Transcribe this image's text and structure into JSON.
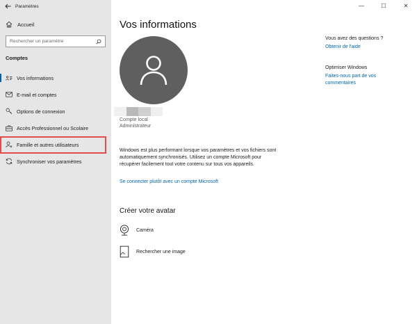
{
  "window": {
    "title": "Paramètres",
    "controls": [
      "—",
      "☐",
      "✕"
    ]
  },
  "sidebar": {
    "home_label": "Accueil",
    "search_placeholder": "Rechercher un paramètre",
    "section_title": "Comptes",
    "items": [
      {
        "label": "Vos informations",
        "icon": "person-card-icon",
        "active": true
      },
      {
        "label": "E-mail et comptes",
        "icon": "mail-icon",
        "active": false
      },
      {
        "label": "Options de connexion",
        "icon": "key-icon",
        "active": false
      },
      {
        "label": "Accès Professionnel ou Scolaire",
        "icon": "briefcase-icon",
        "active": false
      },
      {
        "label": "Famille et autres utilisateurs",
        "icon": "person-add-icon",
        "active": false,
        "highlighted": true
      },
      {
        "label": "Synchroniser vos paramètres",
        "icon": "sync-icon",
        "active": false
      }
    ]
  },
  "main": {
    "title": "Vos informations",
    "account_type": "Compte local",
    "account_role": "Administrateur",
    "sync_text": "Windows est plus performant lorsque vos paramètres et vos fichiers sont automatiquement synchronisés. Utilisez un compte Microsoft pour récupérer facilement tout votre contenu sur tous vos appareils.",
    "ms_link": "Se connecter plutôt avec un compte Microsoft",
    "avatar_section_title": "Créer votre avatar",
    "avatar_options": [
      {
        "label": "Caméra",
        "icon": "camera-icon"
      },
      {
        "label": "Rechercher une image",
        "icon": "browse-image-icon"
      }
    ]
  },
  "right_panel": {
    "questions_heading": "Vous avez des questions ?",
    "help_link": "Obtenir de l'aide",
    "improve_heading": "Optimiser Windows",
    "feedback_link": "Faites-nous part de vos commentaires"
  },
  "colors": {
    "accent": "#0067b8",
    "sidebar_bg": "#e6e6e6",
    "avatar_bg": "#5f5f5f",
    "highlight": "#e24c4c"
  }
}
